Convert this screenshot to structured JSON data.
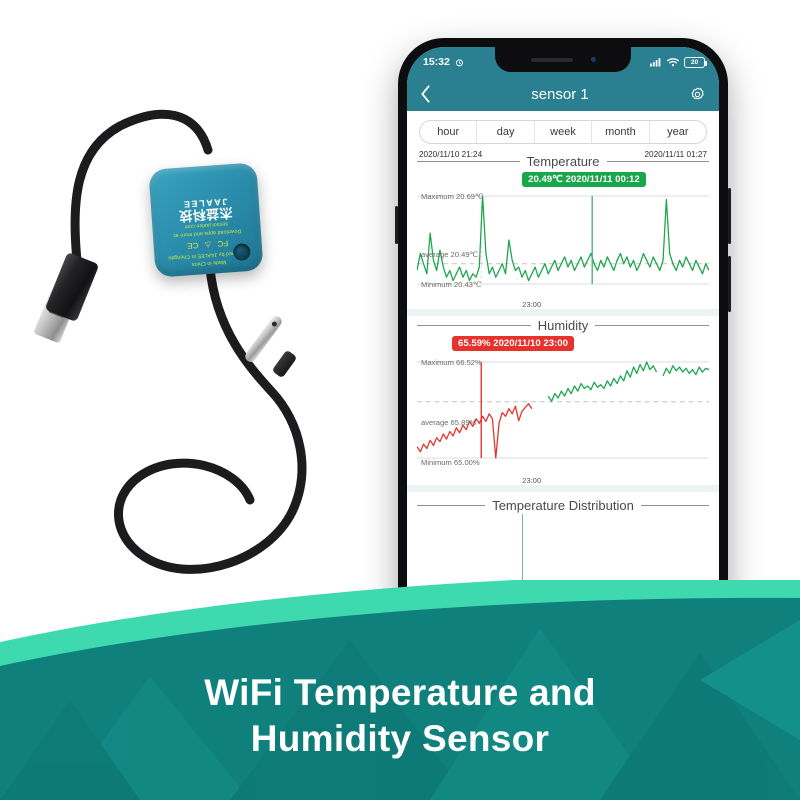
{
  "banner": {
    "line1": "WiFi  Temperature and",
    "line2": "Humidity Sensor",
    "mint": "#3fd9b0",
    "teal_dark": "#10807c",
    "teal_mid": "#14918b"
  },
  "device": {
    "line_made": "Made in China",
    "line_design": "Designed by JAALEE in Chengdu",
    "certs": [
      "FC",
      "⚠",
      "CE"
    ],
    "line_download": "Download apps and more at:",
    "line_site": "sensor.jaalee.com",
    "brand": "JAALEE",
    "brand_cn": "杰益科技",
    "body_color": "#2b8fad"
  },
  "phone": {
    "statusbar": {
      "time": "15:32",
      "alarm_icon": "alarm-icon",
      "signal_icon": "cellular-icon",
      "wifi_icon": "wifi-icon",
      "battery_level": "20"
    },
    "navbar": {
      "back_icon": "back-chevron-icon",
      "title": "sensor 1",
      "settings_icon": "gear-icon"
    },
    "tabs": [
      {
        "label": "hour"
      },
      {
        "label": "day"
      },
      {
        "label": "week"
      },
      {
        "label": "month"
      },
      {
        "label": "year"
      }
    ],
    "range": {
      "start": "2020/11/10 21:24",
      "end": "2020/11/11 01:27"
    },
    "sections": [
      {
        "title": "Temperature",
        "axis_x": "23:00"
      },
      {
        "title": "Humidity",
        "axis_x": "23:00"
      },
      {
        "title": "Temperature Distribution"
      }
    ]
  },
  "chart_data": [
    {
      "type": "line",
      "title": "Temperature",
      "xlabel": "",
      "ylabel": "°C",
      "x_start": "2020/11/10 21:24",
      "x_end": "2020/11/11 01:27",
      "xticks": [
        "23:00"
      ],
      "ylim": [
        20.43,
        20.69
      ],
      "grid": true,
      "legend": "none",
      "color": "#1aa64b",
      "annotations": [
        {
          "text": "Maximum 20.69℃",
          "value": 20.69,
          "kind": "max-line"
        },
        {
          "text": "average 20.49℃",
          "value": 20.49,
          "kind": "avg-line-dashed"
        },
        {
          "text": "Minimum 20.43℃",
          "value": 20.43,
          "kind": "min-line"
        },
        {
          "text": "20.49℃ 2020/11/11 00:12",
          "kind": "cursor-callout",
          "color": "#1aa64b"
        }
      ],
      "series": [
        {
          "name": "Temperature",
          "values": [
            20.47,
            20.52,
            20.49,
            20.46,
            20.58,
            20.5,
            20.47,
            20.53,
            20.48,
            20.45,
            20.47,
            20.44,
            20.46,
            20.48,
            20.45,
            20.47,
            20.44,
            20.46,
            20.45,
            20.48,
            20.69,
            20.52,
            20.46,
            20.48,
            20.45,
            20.47,
            20.49,
            20.46,
            20.56,
            20.5,
            20.47,
            20.48,
            20.45,
            20.47,
            20.44,
            20.46,
            20.48,
            20.45,
            20.47,
            20.49,
            20.46,
            20.48,
            20.5,
            20.47,
            20.49,
            20.51,
            20.48,
            20.5,
            20.47,
            20.49,
            20.51,
            20.48,
            20.5,
            20.52,
            20.49,
            20.47,
            20.5,
            20.48,
            20.51,
            20.49,
            20.47,
            20.5,
            20.52,
            20.49,
            20.51,
            20.48,
            20.5,
            20.47,
            20.49,
            20.52,
            20.5,
            20.48,
            20.51,
            20.49,
            20.47,
            20.5,
            20.68,
            20.52,
            20.49,
            20.47,
            20.5,
            20.48,
            20.51,
            20.49,
            20.47,
            20.5,
            20.48,
            20.46,
            20.49,
            20.47
          ]
        }
      ]
    },
    {
      "type": "line",
      "title": "Humidity",
      "xlabel": "",
      "ylabel": "%",
      "x_start": "2020/11/10 21:24",
      "x_end": "2020/11/11 01:27",
      "xticks": [
        "23:00"
      ],
      "ylim": [
        65.0,
        66.52
      ],
      "grid": true,
      "legend": "none",
      "color_below_avg": "#e8312a",
      "color_above_avg": "#1aa64b",
      "annotations": [
        {
          "text": "Maximum 66.52%",
          "value": 66.52,
          "kind": "max-line"
        },
        {
          "text": "average 65.89%",
          "value": 65.89,
          "kind": "avg-line-dashed"
        },
        {
          "text": "Minimum 65.00%",
          "value": 65.0,
          "kind": "min-line"
        },
        {
          "text": "65.59% 2020/11/10 23:00",
          "kind": "cursor-callout",
          "color": "#e8312a"
        }
      ],
      "series": [
        {
          "name": "Humidity",
          "values": [
            65.18,
            65.1,
            65.22,
            65.15,
            65.28,
            65.2,
            65.32,
            65.26,
            65.38,
            65.3,
            65.42,
            65.35,
            65.48,
            65.4,
            65.52,
            65.45,
            65.58,
            65.5,
            65.62,
            65.55,
            65.66,
            65.58,
            65.7,
            65.62,
            65.0,
            65.55,
            65.72,
            65.66,
            65.78,
            65.7,
            65.82,
            65.59,
            65.74,
            65.8,
            65.86,
            65.78,
            65.9,
            65.84,
            65.94,
            65.88,
            65.98,
            65.9,
            66.02,
            65.95,
            66.06,
            65.98,
            66.1,
            66.02,
            66.14,
            66.06,
            66.18,
            66.1,
            66.14,
            66.08,
            66.2,
            66.12,
            66.16,
            66.1,
            66.22,
            66.14,
            66.26,
            66.18,
            66.3,
            66.22,
            66.38,
            66.28,
            66.44,
            66.34,
            66.48,
            66.38,
            66.52,
            66.4,
            66.46,
            66.36,
            65.86,
            66.3,
            66.42,
            66.34,
            66.46,
            66.38,
            66.44,
            66.36,
            66.42,
            66.34,
            66.4,
            66.32,
            66.44,
            66.36,
            66.42,
            66.4
          ]
        }
      ]
    }
  ]
}
